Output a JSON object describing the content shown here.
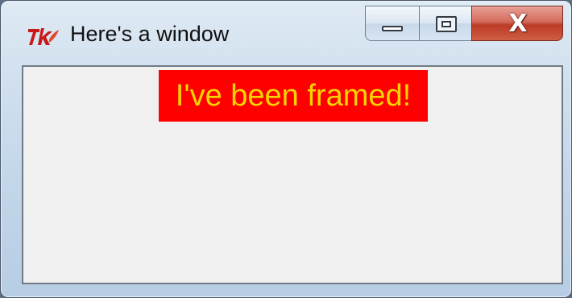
{
  "window": {
    "title": "Here's a window",
    "app_icon": "tk-feather-icon",
    "title_bar": {
      "minimize_icon": "minimize-icon",
      "maximize_icon": "maximize-icon",
      "close_icon": "close-icon",
      "close_glyph": "X"
    }
  },
  "content": {
    "label_text": "I've been framed!",
    "label_background": "#ff0000",
    "label_foreground": "#f5d400"
  },
  "colors": {
    "client_background": "#f0f0f0",
    "close_button": "#c8453a"
  }
}
